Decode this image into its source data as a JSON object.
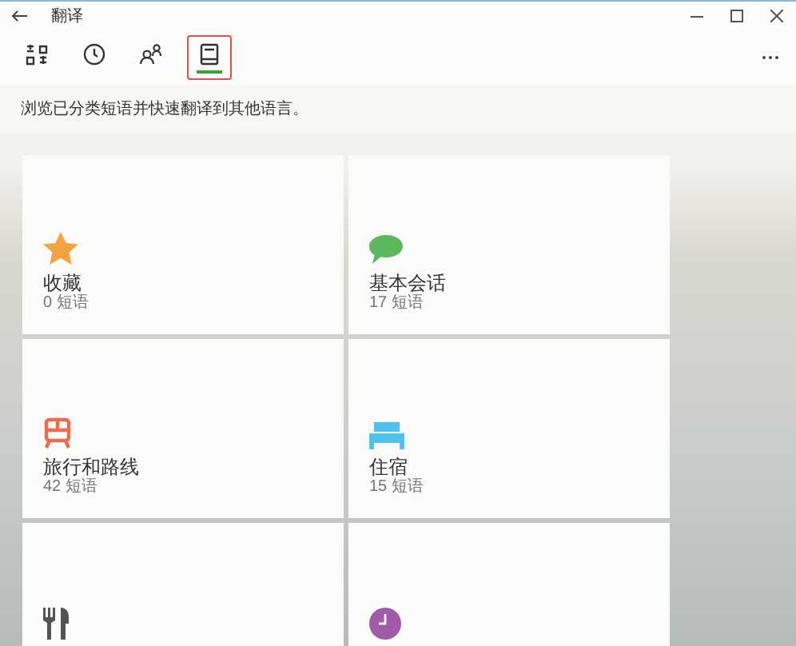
{
  "window": {
    "title": "翻译"
  },
  "tabs": [
    {
      "kind": "translate",
      "selected": false
    },
    {
      "kind": "history",
      "selected": false
    },
    {
      "kind": "conversation",
      "selected": false
    },
    {
      "kind": "phrasebook",
      "selected": true
    }
  ],
  "description": "浏览已分类短语并快速翻译到其他语言。",
  "categories": [
    {
      "kind": "star",
      "color": "#f4a340",
      "title": "收藏",
      "count": "0 短语"
    },
    {
      "kind": "chat",
      "color": "#5cb85c",
      "title": "基本会话",
      "count": "17 短语"
    },
    {
      "kind": "train",
      "color": "#ee6b4d",
      "title": "旅行和路线",
      "count": "42 短语"
    },
    {
      "kind": "bed",
      "color": "#4fc1ee",
      "title": "住宿",
      "count": "15 短语"
    },
    {
      "kind": "dining",
      "color": "#555555"
    },
    {
      "kind": "clock",
      "color": "#a25ba8"
    }
  ]
}
